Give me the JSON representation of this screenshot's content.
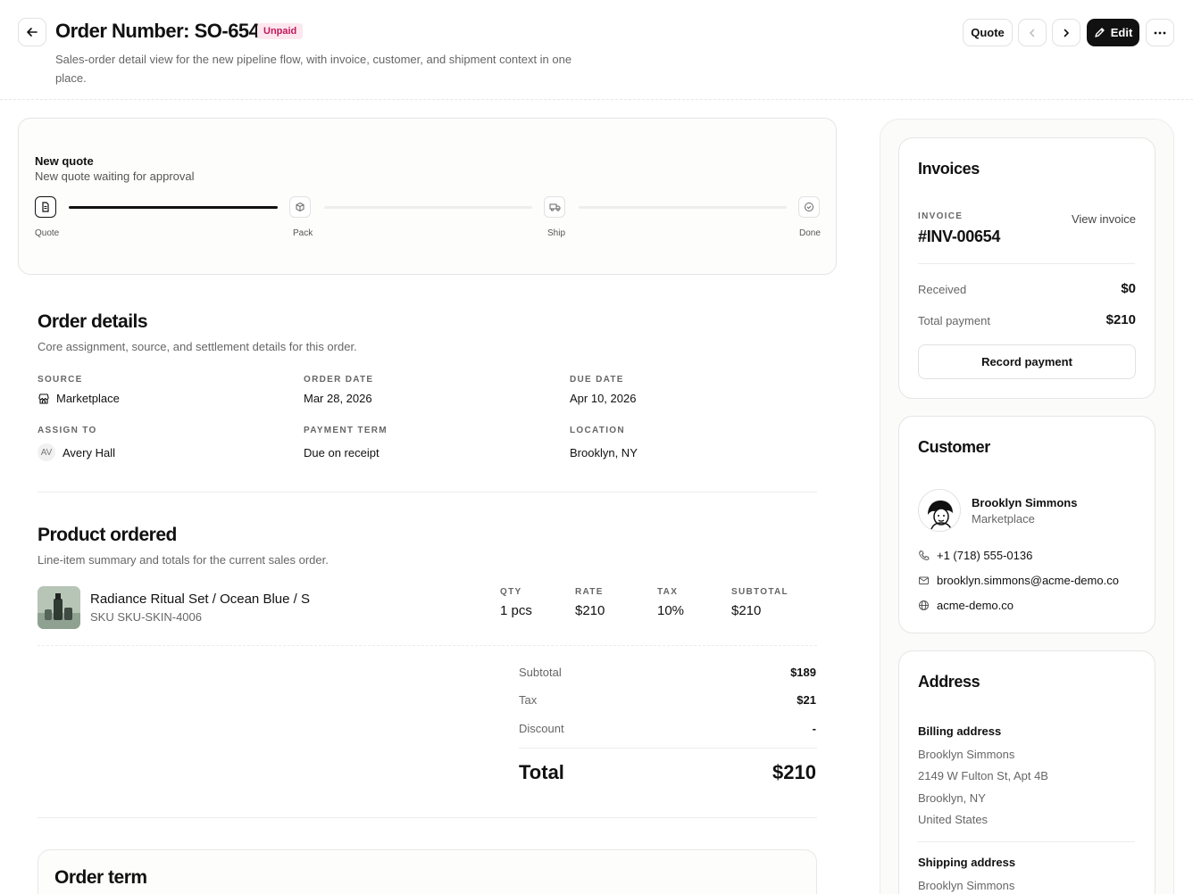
{
  "header": {
    "title": "Order Number: SO-654",
    "status_badge": "Unpaid",
    "subtitle": "Sales-order detail view for the new pipeline flow, with invoice, customer, and shipment context in one place.",
    "quote_button": "Quote",
    "edit_button": "Edit"
  },
  "pipeline": {
    "title": "New quote",
    "subtitle": "New quote waiting for approval",
    "steps": [
      {
        "label": "Quote",
        "icon": "document-icon",
        "active": true
      },
      {
        "label": "Pack",
        "icon": "box-icon",
        "active": false
      },
      {
        "label": "Ship",
        "icon": "truck-icon",
        "active": false
      },
      {
        "label": "Done",
        "icon": "check-circle-icon",
        "active": false
      }
    ]
  },
  "order_details": {
    "title": "Order details",
    "subtitle": "Core assignment, source, and settlement details for this order.",
    "source_label": "SOURCE",
    "source_value": "Marketplace",
    "order_date_label": "ORDER DATE",
    "order_date_value": "Mar 28, 2026",
    "due_date_label": "DUE DATE",
    "due_date_value": "Apr 10, 2026",
    "assign_label": "ASSIGN TO",
    "assign_initials": "AV",
    "assign_value": "Avery Hall",
    "payment_term_label": "PAYMENT TERM",
    "payment_term_value": "Due on receipt",
    "location_label": "LOCATION",
    "location_value": "Brooklyn, NY"
  },
  "product": {
    "title": "Product ordered",
    "subtitle": "Line-item summary and totals for the current sales order.",
    "name": "Radiance Ritual Set / Ocean Blue / S",
    "sku": "SKU SKU-SKIN-4006",
    "qty_label": "QTY",
    "qty_value": "1 pcs",
    "rate_label": "RATE",
    "rate_value": "$210",
    "tax_label": "TAX",
    "tax_value": "10%",
    "subtotal_label": "SUBTOTAL",
    "subtotal_value": "$210"
  },
  "summary": {
    "subtotal_label": "Subtotal",
    "subtotal_value": "$189",
    "tax_label": "Tax",
    "tax_value": "$21",
    "discount_label": "Discount",
    "discount_value": "-",
    "total_label": "Total",
    "total_value": "$210"
  },
  "order_term": {
    "title": "Order term"
  },
  "invoices": {
    "title": "Invoices",
    "invoice_label": "INVOICE",
    "invoice_number": "#INV-00654",
    "view_link": "View invoice",
    "received_label": "Received",
    "received_value": "$0",
    "total_payment_label": "Total payment",
    "total_payment_value": "$210",
    "record_button": "Record payment"
  },
  "customer": {
    "title": "Customer",
    "name": "Brooklyn Simmons",
    "source": "Marketplace",
    "phone": "+1 (718) 555-0136",
    "email": "brooklyn.simmons@acme-demo.co",
    "website": "acme-demo.co"
  },
  "address": {
    "title": "Address",
    "billing_title": "Billing address",
    "billing_lines": [
      "Brooklyn Simmons",
      "2149 W Fulton St, Apt 4B",
      "Brooklyn, NY",
      "United States"
    ],
    "shipping_title": "Shipping address",
    "shipping_lines": [
      "Brooklyn Simmons"
    ]
  }
}
